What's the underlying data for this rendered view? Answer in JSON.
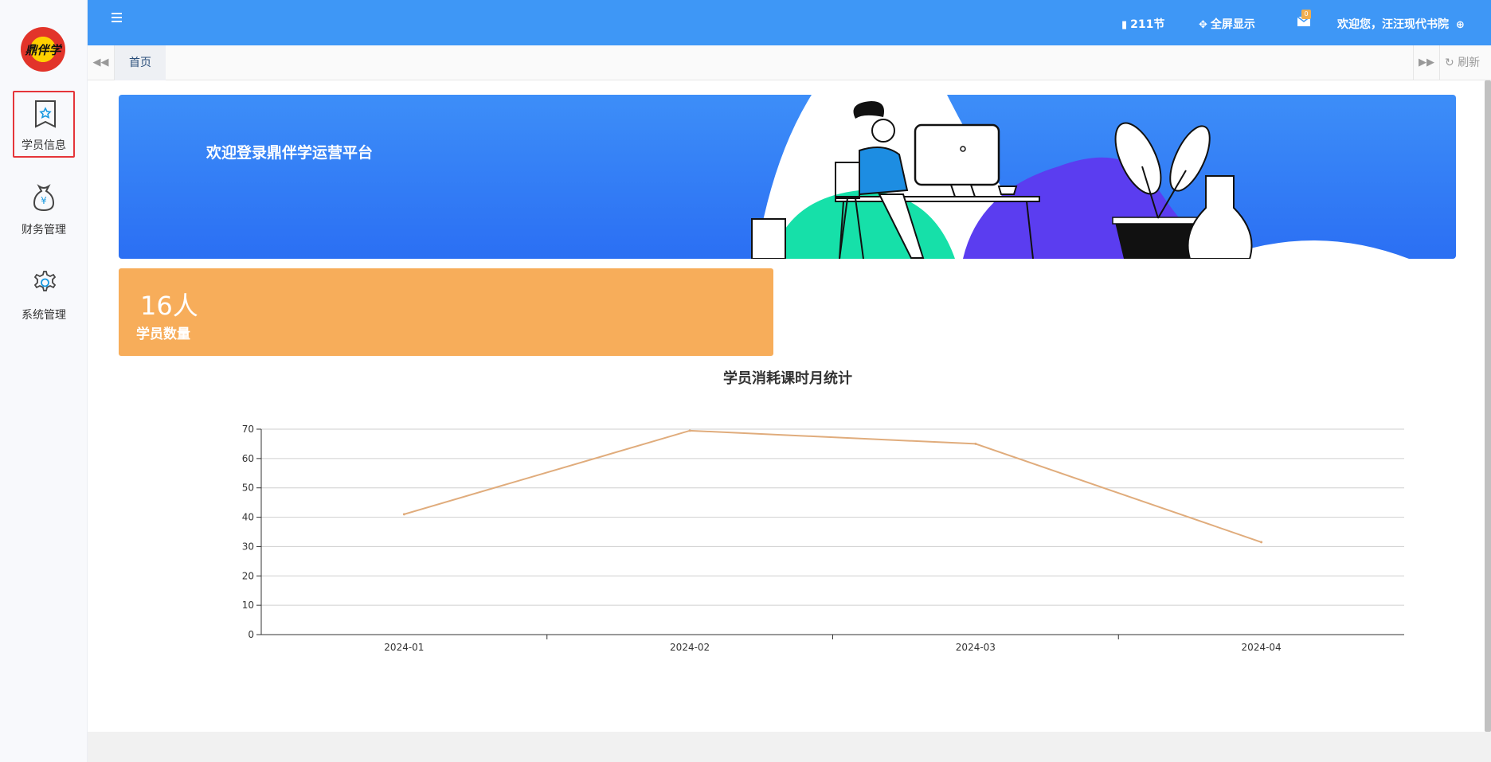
{
  "logo": {
    "text": "鼎伴学"
  },
  "sidebar": {
    "items": [
      {
        "label": "学员信息",
        "icon": "student-card-icon",
        "active": true
      },
      {
        "label": "财务管理",
        "icon": "money-bag-icon",
        "active": false
      },
      {
        "label": "系统管理",
        "icon": "gear-icon",
        "active": false
      }
    ]
  },
  "header": {
    "hours": "211节",
    "fullscreen": "全屏显示",
    "mail_badge": "0",
    "welcome": "欢迎您，汪汪现代书院"
  },
  "tabs": {
    "home": "首页",
    "refresh": "刷新"
  },
  "banner": {
    "title": "欢迎登录鼎伴学运营平台"
  },
  "stat": {
    "value": "16人",
    "label": "学员数量"
  },
  "colors": {
    "header": "#3e97f6",
    "card": "#f7ad5a",
    "line": "#e0ac7c",
    "active_border": "#e5353a"
  },
  "chart_data": {
    "type": "line",
    "title": "学员消耗课时月统计",
    "categories": [
      "2024-01",
      "2024-02",
      "2024-03",
      "2024-04"
    ],
    "values": [
      41,
      69.5,
      65,
      31.5
    ],
    "ylim": [
      0,
      70
    ],
    "yticks": [
      0,
      10,
      20,
      30,
      40,
      50,
      60,
      70
    ],
    "grid": true,
    "legend": "none"
  }
}
